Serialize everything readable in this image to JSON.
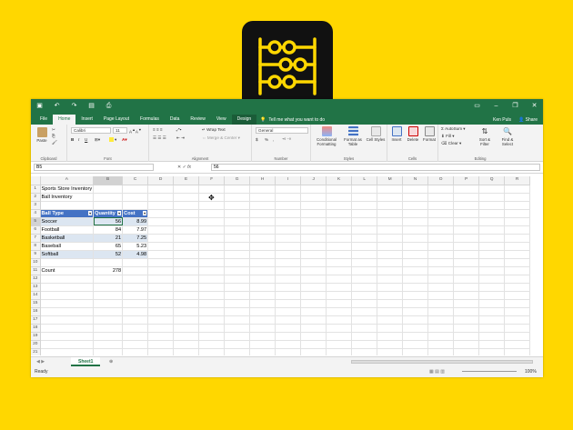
{
  "window": {
    "quick_access": [
      "save-icon",
      "undo-icon",
      "redo-icon",
      "open-icon",
      "print-icon"
    ],
    "controls": [
      "ribbon-options-icon",
      "minimize-icon",
      "restore-icon",
      "close-icon"
    ]
  },
  "tabs": [
    "File",
    "Home",
    "Insert",
    "Page Layout",
    "Formulas",
    "Data",
    "Review",
    "View",
    "Design"
  ],
  "active_tab": "Home",
  "tell_me": "Tell me what you want to do",
  "user": "Ken Puls",
  "share": "Share",
  "ribbon": {
    "clipboard": {
      "paste": "Paste",
      "label": "Clipboard"
    },
    "font": {
      "name": "Calibri",
      "size": "11",
      "label": "Font",
      "bold": "B",
      "italic": "I",
      "underline": "U"
    },
    "alignment": {
      "wrap": "Wrap Text",
      "merge": "Merge & Center",
      "label": "Alignment"
    },
    "number": {
      "format": "General",
      "currency": "$",
      "percent": "%",
      "comma": ",",
      "label": "Number"
    },
    "styles": {
      "conditional": "Conditional Formatting",
      "table": "Format as Table",
      "cell": "Cell Styles",
      "label": "Styles"
    },
    "cells": {
      "insert": "Insert",
      "delete": "Delete",
      "format": "Format",
      "label": "Cells"
    },
    "editing": {
      "autosum": "AutoSum",
      "fill": "Fill",
      "clear": "Clear",
      "sort": "Sort & Filter",
      "find": "Find & Select",
      "label": "Editing"
    }
  },
  "formula_bar": {
    "name_box": "B5",
    "fx": "fx",
    "value": "56"
  },
  "columns": [
    "A",
    "B",
    "C",
    "D",
    "E",
    "F",
    "G",
    "H",
    "I",
    "J",
    "K",
    "L",
    "M",
    "N",
    "O",
    "P",
    "Q",
    "R"
  ],
  "cells": {
    "a1": "Sports Store Inventory",
    "a2": "Ball Inventory",
    "table_headers": [
      "Ball Type",
      "Quantity",
      "Cost"
    ],
    "rows": [
      {
        "type": "Soccer",
        "qty": "56",
        "cost": "8.99"
      },
      {
        "type": "Football",
        "qty": "84",
        "cost": "7.97"
      },
      {
        "type": "Basketball",
        "qty": "21",
        "cost": "7.25"
      },
      {
        "type": "Baseball",
        "qty": "65",
        "cost": "5.23"
      },
      {
        "type": "Softball",
        "qty": "52",
        "cost": "4.98"
      }
    ],
    "count_label": "Count",
    "count_value": "278"
  },
  "sheet": "Sheet1",
  "status": "Ready",
  "zoom": "100%"
}
